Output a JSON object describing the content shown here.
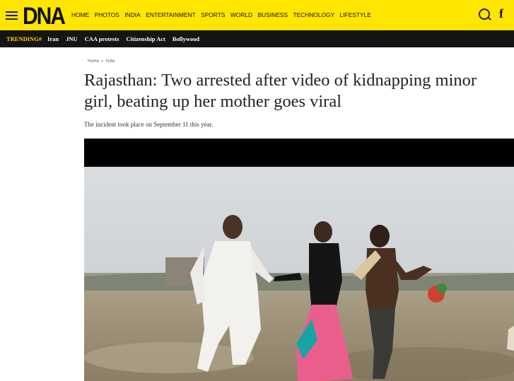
{
  "header": {
    "logo": "DNA",
    "nav": [
      "HOME",
      "PHOTOS",
      "INDIA",
      "ENTERTAINMENT",
      "SPORTS",
      "WORLD",
      "BUSINESS",
      "TECHNOLOGY",
      "LIFESTYLE"
    ],
    "icons": [
      "menu-icon",
      "search-icon",
      "facebook-icon"
    ],
    "facebook_glyph": "f"
  },
  "trending": {
    "label": "TRENDING#",
    "items": [
      "Iran",
      "JNU",
      "CAA protests",
      "Citizenship Act",
      "Bollywood"
    ]
  },
  "breadcrumb": {
    "home": "Home",
    "separator": "»",
    "section": "India"
  },
  "article": {
    "headline": "Rajasthan: Two arrested after video of kidnapping minor girl, beating up her mother goes viral",
    "subheading": "The incident took place on September 11 this year."
  },
  "colors": {
    "brand_yellow": "#ffe600",
    "trending_bar": "#151515",
    "trending_label": "#ffd000"
  }
}
